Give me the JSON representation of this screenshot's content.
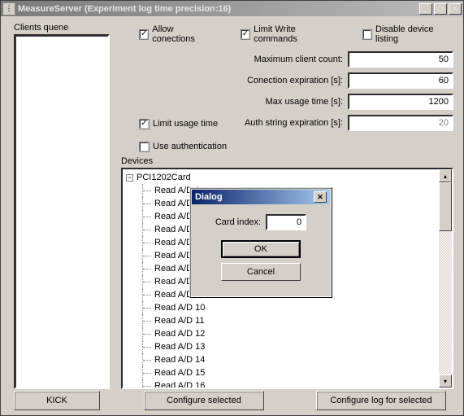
{
  "window": {
    "title": "MeasureServer (Experiment log time precision:16)"
  },
  "labels": {
    "clients_queue": "Clients quene",
    "devices": "Devices"
  },
  "checkboxes": {
    "allow_connections": {
      "label": "Allow conections",
      "checked": true
    },
    "limit_write": {
      "label": "Limit Write commands",
      "checked": true
    },
    "disable_listing": {
      "label": "Disable device listing",
      "checked": false
    },
    "limit_usage": {
      "label": "Limit usage time",
      "checked": true
    },
    "use_auth": {
      "label": "Use authentication",
      "checked": false
    }
  },
  "settings": {
    "max_client_count": {
      "label": "Maximum client count:",
      "value": "50"
    },
    "conn_expiration": {
      "label": "Conection expiration [s]:",
      "value": "60"
    },
    "max_usage_time": {
      "label": "Max usage time [s]:",
      "value": "1200"
    },
    "auth_expiration": {
      "label": "Auth string expiration [s]:",
      "value": "20",
      "disabled": true
    }
  },
  "tree": {
    "root": "PCI1202Card",
    "children": [
      "Read A/D 1",
      "Read A/D 2",
      "Read A/D 3",
      "Read A/D 4",
      "Read A/D 5",
      "Read A/D 6",
      "Read A/D 7",
      "Read A/D 8",
      "Read A/D 9",
      "Read A/D 10",
      "Read A/D 11",
      "Read A/D 12",
      "Read A/D 13",
      "Read A/D 14",
      "Read A/D 15",
      "Read A/D 16"
    ]
  },
  "buttons": {
    "kick": "KICK",
    "configure_selected": "Configure selected",
    "configure_log": "Configure log for selected"
  },
  "dialog": {
    "title": "Dialog",
    "card_index_label": "Card index:",
    "card_index_value": "0",
    "ok": "OK",
    "cancel": "Cancel"
  }
}
